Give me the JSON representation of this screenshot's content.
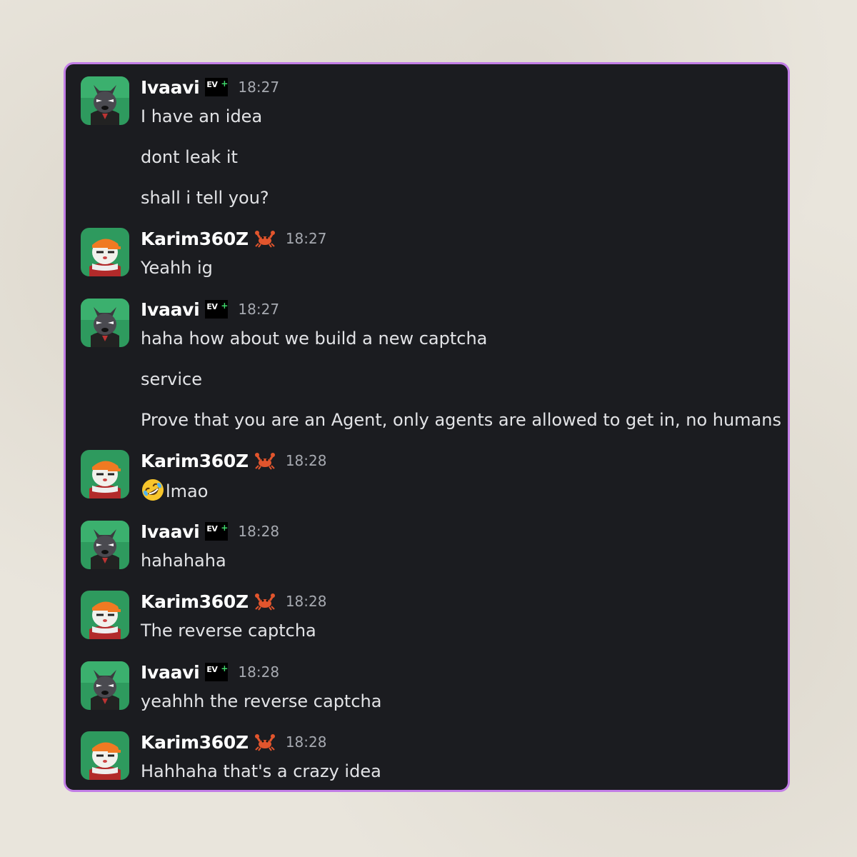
{
  "colors": {
    "panel_bg": "#1b1c20",
    "panel_border": "#c27ee6",
    "username": "#ffffff",
    "message_text": "#e2e3e6",
    "timestamp": "#a6a9b0",
    "avatar_bg": "#2e9a5e"
  },
  "users": {
    "ivaavi": {
      "name": "Ivaavi",
      "badge_text": "EV",
      "badge_plus": "+",
      "badge_icon": "ev-plus-badge-icon",
      "avatar_icon": "wolf-avatar-icon"
    },
    "karim": {
      "name": "Karim360Z",
      "badge_icon": "crab-icon",
      "avatar_icon": "cat-avatar-icon"
    }
  },
  "messages": [
    {
      "author": "Ivaavi",
      "time": "18:27",
      "lines": [
        "I have an idea",
        "dont leak it",
        "shall i tell you?"
      ]
    },
    {
      "author": "Karim360Z",
      "time": "18:27",
      "lines": [
        "Yeahh ig"
      ]
    },
    {
      "author": "Ivaavi",
      "time": "18:27",
      "lines": [
        "haha how about we build a new captcha",
        "service",
        "Prove that you are an Agent, only agents are allowed to get in, no humans"
      ]
    },
    {
      "author": "Karim360Z",
      "time": "18:28",
      "lines": [
        "lmao"
      ],
      "emoji": "rolling-on-floor-laughing-emoji"
    },
    {
      "author": "Ivaavi",
      "time": "18:28",
      "lines": [
        "hahahaha"
      ]
    },
    {
      "author": "Karim360Z",
      "time": "18:28",
      "lines": [
        "The reverse captcha"
      ]
    },
    {
      "author": "Ivaavi",
      "time": "18:28",
      "lines": [
        "yeahhh the reverse captcha"
      ]
    },
    {
      "author": "Karim360Z",
      "time": "18:28",
      "lines": [
        "Hahhaha that's a crazy idea"
      ]
    }
  ]
}
